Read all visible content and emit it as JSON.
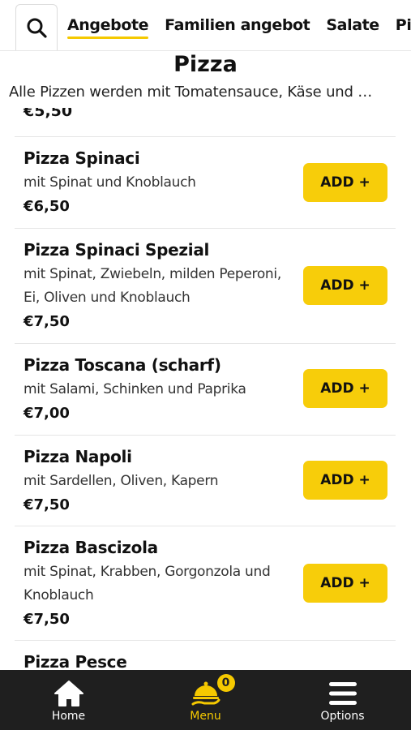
{
  "categories": {
    "search_icon": "search-icon",
    "tabs": [
      {
        "label": "Angebote",
        "active": true
      },
      {
        "label": "Familien angebot",
        "active": false
      },
      {
        "label": "Salate",
        "active": false
      },
      {
        "label": "Pizza",
        "active": false
      }
    ]
  },
  "section": {
    "title": "Pizza",
    "description": "Alle Pizzen werden mit Tomatensauce, Käse und …"
  },
  "previous_price": "€5,50",
  "items": [
    {
      "name": "Pizza Spinaci",
      "description": "mit Spinat und Knoblauch",
      "price": "€6,50",
      "add_label": "ADD +"
    },
    {
      "name": "Pizza Spinaci Spezial",
      "description": "mit Spinat, Zwiebeln, milden Peperoni, Ei, Oliven und Knoblauch",
      "price": "€7,50",
      "add_label": "ADD +"
    },
    {
      "name": "Pizza Toscana (scharf)",
      "description": "mit Salami, Schinken und Paprika",
      "price": "€7,00",
      "add_label": "ADD +"
    },
    {
      "name": "Pizza Napoli",
      "description": "mit Sardellen, Oliven, Kapern",
      "price": "€7,50",
      "add_label": "ADD +"
    },
    {
      "name": "Pizza Bascizola",
      "description": "mit Spinat, Krabben, Gorgonzola und Knoblauch",
      "price": "€7,50",
      "add_label": "ADD +"
    },
    {
      "name": "Pizza Pesce",
      "description": "",
      "price": "",
      "add_label": ""
    }
  ],
  "bottom_nav": {
    "home": {
      "label": "Home",
      "icon": "home-icon"
    },
    "menu": {
      "label": "Menu",
      "icon": "cloche-icon",
      "badge": "0"
    },
    "options": {
      "label": "Options",
      "icon": "hamburger-icon"
    }
  },
  "colors": {
    "accent": "#f7cd0a",
    "nav_bg": "#1f1f1f"
  }
}
